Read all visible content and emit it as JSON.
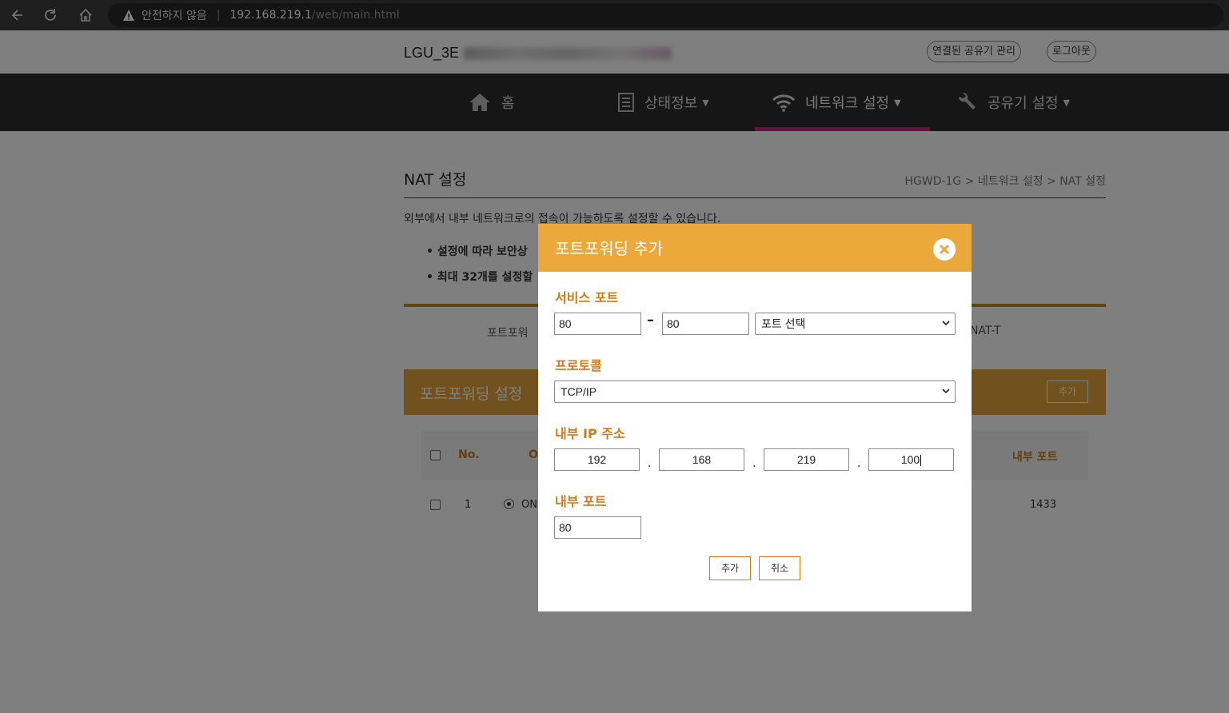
{
  "browser": {
    "security_label": "안전하지 않음",
    "url_host": "192.168.219.1",
    "url_path": "/web/main.html"
  },
  "topbar": {
    "device_name": "LGU_3E",
    "connected_mgmt_button": "연결된 공유기 관리",
    "logout_button": "로그아웃"
  },
  "nav": {
    "home": "홈",
    "status": "상태정보",
    "network": "네트워크 설정",
    "router": "공유기 설정"
  },
  "content": {
    "page_title": "NAT 설정",
    "breadcrumb": "HGWD-1G > 네트워크 설정 > NAT 설정",
    "description": "외부에서 내부 네트워크로의 접속이 가능하도록 설정할 수 있습니다.",
    "bullet1": "• 설정에 따라 보안상",
    "bullet2": "• 최대 32개를 설정할",
    "tab_portforward": "포트포워",
    "tab_natt": "NAT-T",
    "section_title": "포트포워딩 설정",
    "section_add": "추가",
    "table_headers": {
      "no": "No.",
      "onoff": "O",
      "internal_port": "내부 포트"
    },
    "row1": {
      "no": "1",
      "state": "ON",
      "internal_port": "1433"
    }
  },
  "modal": {
    "title": "포트포워딩 추가",
    "service_port_label": "서비스 포트",
    "service_port_start": "80",
    "service_port_end": "80",
    "port_select": "포트 선택",
    "protocol_label": "프로토콜",
    "protocol_value": "TCP/IP",
    "internal_ip_label": "내부 IP 주소",
    "ip1": "192",
    "ip2": "168",
    "ip3": "219",
    "ip4": "100",
    "internal_port_label": "내부 포트",
    "internal_port_value": "80",
    "add_button": "추가",
    "cancel_button": "취소"
  },
  "colors": {
    "modal_header": "#eca93b",
    "label_orange": "#d17a1a",
    "nav_bg": "#2d2d2d",
    "nav_active": "#c8207a"
  }
}
